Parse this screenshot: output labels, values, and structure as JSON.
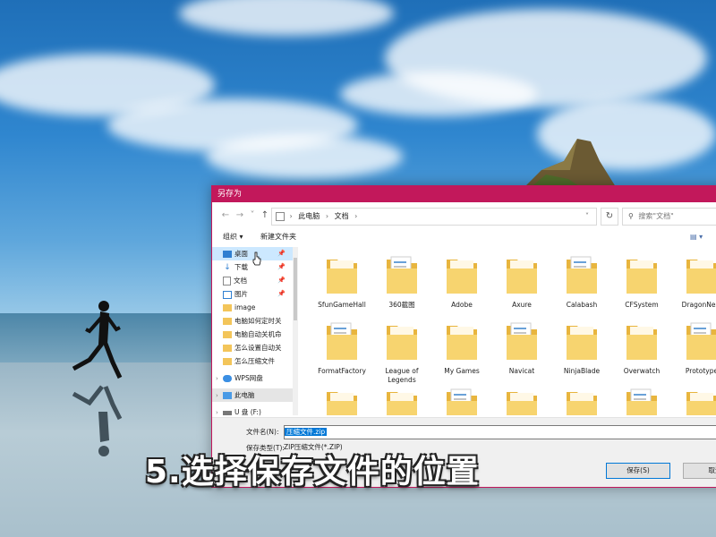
{
  "colors": {
    "titlebar": "#c2185b",
    "selection": "#cce8ff",
    "highlight": "#0078d7"
  },
  "dialog": {
    "title": "另存为",
    "address": [
      "此电脑",
      "文档"
    ],
    "search_placeholder": "搜索\"文档\"",
    "toolbar": {
      "organize": "组织 ▾",
      "new_folder": "新建文件夹"
    }
  },
  "nav": {
    "quick": [
      {
        "label": "桌面",
        "icon": "desktop-icon",
        "pinned": true,
        "selected": true
      },
      {
        "label": "下载",
        "icon": "download-icon",
        "pinned": true
      },
      {
        "label": "文档",
        "icon": "document-icon",
        "pinned": true
      },
      {
        "label": "图片",
        "icon": "picture-icon",
        "pinned": true
      },
      {
        "label": "image",
        "icon": "folder-icon"
      },
      {
        "label": "电脑如何定时关",
        "icon": "folder-icon"
      },
      {
        "label": "电脑自动关机命",
        "icon": "folder-icon"
      },
      {
        "label": "怎么设置自动关",
        "icon": "folder-icon"
      },
      {
        "label": "怎么压缩文件",
        "icon": "folder-icon"
      }
    ],
    "wps": "WPS网盘",
    "pc": "此电脑",
    "drive": "U 盘 (F:)"
  },
  "files": [
    "SfunGameHall",
    "360截图",
    "Adobe",
    "Axure",
    "Calabash",
    "CFSystem",
    "DragonNest",
    "FormatFactory",
    "League of Legends",
    "My Games",
    "Navicat",
    "NinjaBlade",
    "Overwatch",
    "Prototype"
  ],
  "form": {
    "filename_label": "文件名(N):",
    "filename_value": "压缩文件.zip",
    "type_label": "保存类型(T):",
    "type_value": "ZIP压缩文件(*.ZIP)",
    "save_button": "保存(S)",
    "cancel_button": "取消"
  },
  "caption": "5.选择保存文件的位置"
}
